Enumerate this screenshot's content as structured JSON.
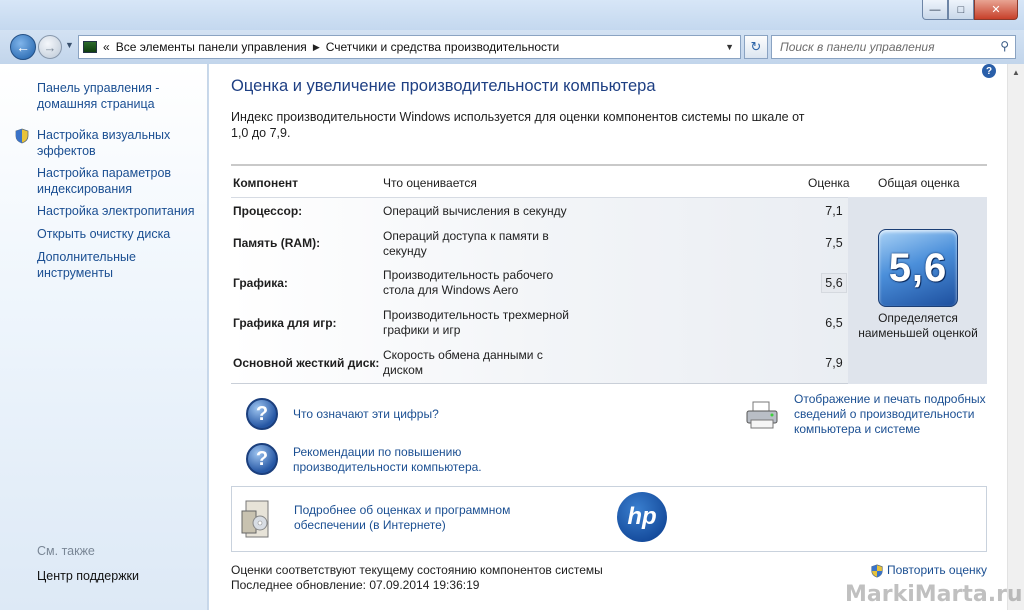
{
  "window": {
    "minimize_icon": "minimize-icon",
    "maximize_icon": "maximize-icon",
    "close_label": "✕"
  },
  "nav": {
    "back_icon": "back-arrow-icon",
    "forward_icon": "forward-arrow-icon",
    "breadcrumb_overflow": "«",
    "breadcrumbs": [
      "Все элементы панели управления",
      "Счетчики и средства производительности"
    ],
    "search_placeholder": "Поиск в панели управления"
  },
  "sidebar": {
    "items": [
      {
        "label": "Панель управления - домашняя страница",
        "shield": false
      },
      {
        "label": "Настройка визуальных эффектов",
        "shield": true
      },
      {
        "label": "Настройка параметров индексирования",
        "shield": false
      },
      {
        "label": "Настройка электропитания",
        "shield": false
      },
      {
        "label": "Открыть очистку диска",
        "shield": false
      },
      {
        "label": "Дополнительные инструменты",
        "shield": false
      }
    ],
    "see_also": "См. также",
    "support_center": "Центр поддержки"
  },
  "main": {
    "title": "Оценка и увеличение производительности компьютера",
    "intro": "Индекс производительности Windows используется для оценки компонентов системы по шкале от 1,0 до 7,9.",
    "table": {
      "headers": [
        "Компонент",
        "Что оценивается",
        "Оценка",
        "Общая оценка"
      ],
      "rows": [
        {
          "component": "Процессор:",
          "desc": "Операций вычисления в секунду",
          "score": "7,1"
        },
        {
          "component": "Память (RAM):",
          "desc": "Операций доступа к памяти в секунду",
          "score": "7,5"
        },
        {
          "component": "Графика:",
          "desc": "Производительность рабочего стола для Windows Aero",
          "score": "5,6"
        },
        {
          "component": "Графика для игр:",
          "desc": "Производительность трехмерной графики и игр",
          "score": "6,5"
        },
        {
          "component": "Основной жесткий диск:",
          "desc": "Скорость обмена данными с диском",
          "score": "7,9"
        }
      ],
      "overall": "5,6",
      "overall_caption": "Определяется наименьшей оценкой"
    },
    "links": {
      "what_mean": "Что означают эти цифры?",
      "tips": "Рекомендации по повышению производительности компьютера.",
      "print": "Отображение и печать подробных сведений о производительности компьютера и системе",
      "more_info": "Подробнее об оценках и программном обеспечении (в Интернете)"
    },
    "hp_logo": "hp",
    "footer": {
      "status": "Оценки соответствуют текущему состоянию компонентов системы",
      "last_update": "Последнее обновление: 07.09.2014 19:36:19",
      "rerun": "Повторить оценку"
    }
  },
  "watermark": "MarkiMarta.ru",
  "colors": {
    "link": "#1b4f92",
    "title": "#1e3f83",
    "badge": "#2a63b4"
  }
}
